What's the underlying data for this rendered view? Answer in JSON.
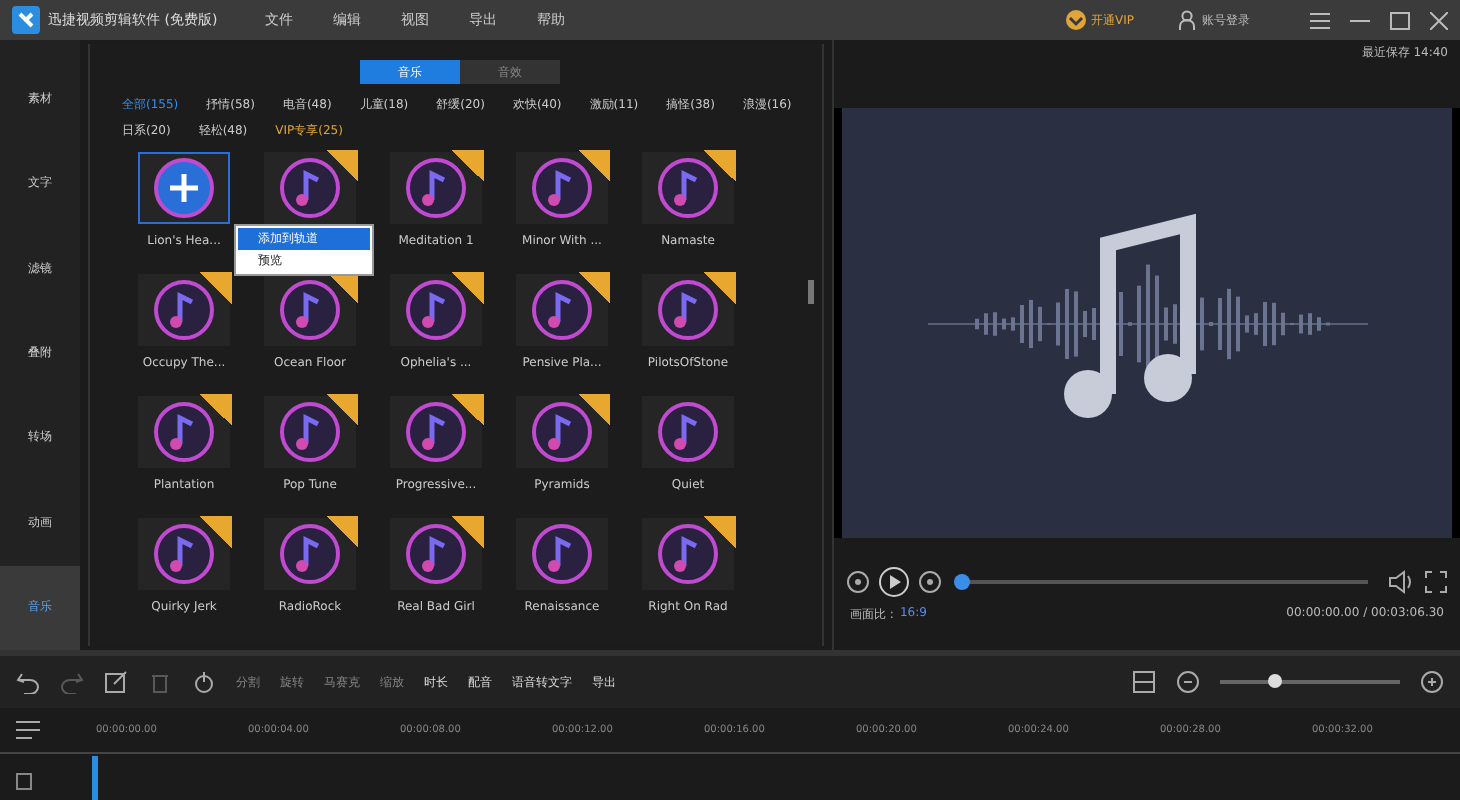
{
  "window": {
    "title": "迅捷视频剪辑软件 (免费版)",
    "menu": [
      "文件",
      "编辑",
      "视图",
      "导出",
      "帮助"
    ],
    "vip": "开通VIP",
    "login": "账号登录"
  },
  "sidebar": {
    "items": [
      {
        "label": "素材",
        "selected": false
      },
      {
        "label": "文字",
        "selected": false
      },
      {
        "label": "滤镜",
        "selected": false
      },
      {
        "label": "叠附",
        "selected": false
      },
      {
        "label": "转场",
        "selected": false
      },
      {
        "label": "动画",
        "selected": false
      },
      {
        "label": "音乐",
        "selected": true
      }
    ]
  },
  "library": {
    "tabs": [
      {
        "label": "音乐",
        "selected": true
      },
      {
        "label": "音效",
        "selected": false
      }
    ],
    "categories": [
      {
        "label": "全部(155)",
        "selected": true,
        "kind": "normal"
      },
      {
        "label": "抒情(58)",
        "selected": false,
        "kind": "normal"
      },
      {
        "label": "电音(48)",
        "selected": false,
        "kind": "normal"
      },
      {
        "label": "儿童(18)",
        "selected": false,
        "kind": "normal"
      },
      {
        "label": "舒缓(20)",
        "selected": false,
        "kind": "normal"
      },
      {
        "label": "欢快(40)",
        "selected": false,
        "kind": "normal"
      },
      {
        "label": "激励(11)",
        "selected": false,
        "kind": "normal"
      },
      {
        "label": "搞怪(38)",
        "selected": false,
        "kind": "normal"
      },
      {
        "label": "浪漫(16)",
        "selected": false,
        "kind": "normal"
      },
      {
        "label": "日系(20)",
        "selected": false,
        "kind": "normal"
      },
      {
        "label": "轻松(48)",
        "selected": false,
        "kind": "normal"
      },
      {
        "label": "VIP专享(25)",
        "selected": false,
        "kind": "vip"
      }
    ],
    "tracks": [
      {
        "name": "Lion's Hea...",
        "vip": false,
        "selected": true
      },
      {
        "vip": true,
        "selected": false
      },
      {
        "name": "Meditation 1",
        "vip": true,
        "selected": false
      },
      {
        "name": "Minor With ...",
        "vip": true,
        "selected": false
      },
      {
        "name": "Namaste",
        "vip": true,
        "selected": false
      },
      {
        "name": "Occupy The...",
        "vip": true,
        "selected": false
      },
      {
        "name": "Ocean Floor",
        "vip": true,
        "selected": false
      },
      {
        "name": "Ophelia's ...",
        "vip": true,
        "selected": false
      },
      {
        "name": "Pensive Pla...",
        "vip": true,
        "selected": false
      },
      {
        "name": "PilotsOfStone",
        "vip": true,
        "selected": false
      },
      {
        "name": "Plantation",
        "vip": true,
        "selected": false
      },
      {
        "name": "Pop Tune",
        "vip": true,
        "selected": false
      },
      {
        "name": "Progressive...",
        "vip": true,
        "selected": false
      },
      {
        "name": "Pyramids",
        "vip": true,
        "selected": false
      },
      {
        "name": "Quiet",
        "vip": false,
        "selected": false
      },
      {
        "name": "Quirky Jerk",
        "vip": true,
        "selected": false
      },
      {
        "name": "RadioRock",
        "vip": true,
        "selected": false
      },
      {
        "name": "Real Bad Girl",
        "vip": true,
        "selected": false
      },
      {
        "name": "Renaissance",
        "vip": false,
        "selected": false
      },
      {
        "name": "Right On Rad",
        "vip": true,
        "selected": false
      }
    ],
    "context_menu": [
      {
        "label": "添加到轨道",
        "selected": true
      },
      {
        "label": "预览",
        "selected": false
      }
    ]
  },
  "preview": {
    "saved": "最近保存 14:40",
    "level": 0.0,
    "aspect_label": "画面比 :",
    "aspect": "16:9",
    "time": "00:00:00.00 / 00:03:06.30"
  },
  "toolbar": [
    {
      "label": "分割",
      "disabled": true
    },
    {
      "label": "旋转",
      "disabled": true
    },
    {
      "label": "马赛克",
      "disabled": true
    },
    {
      "label": "缩放",
      "disabled": true
    },
    {
      "label": "时长",
      "disabled": false
    },
    {
      "label": "配音",
      "disabled": false
    },
    {
      "label": "语音转文字",
      "disabled": false
    },
    {
      "label": "导出",
      "disabled": false
    }
  ],
  "zoom": {
    "level": 0.3
  },
  "timeline": {
    "ticks": [
      "00:00:00.00",
      "00:00:04.00",
      "00:00:08.00",
      "00:00:12.00",
      "00:00:16.00",
      "00:00:20.00",
      "00:00:24.00",
      "00:00:28.00",
      "00:00:32.00"
    ]
  }
}
